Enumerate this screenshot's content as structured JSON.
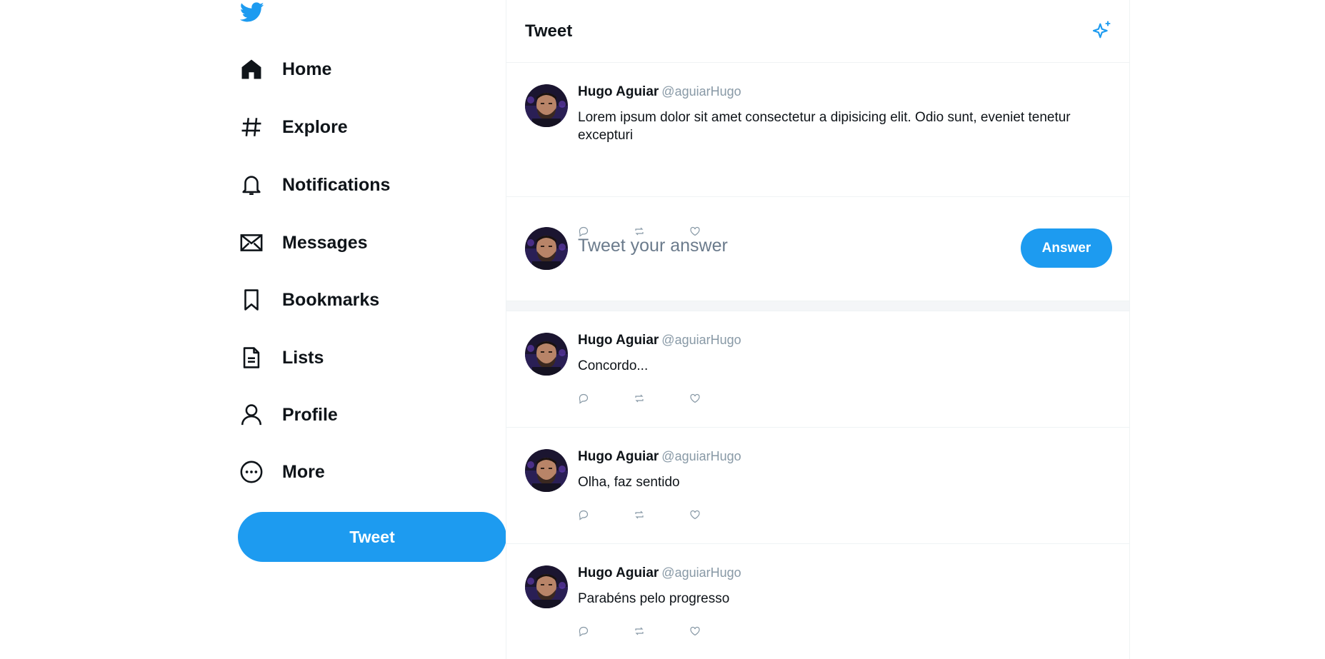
{
  "app": {
    "brand_color": "#1d9bf0"
  },
  "sidebar": {
    "logo_icon": "twitter-bird-icon",
    "items": [
      {
        "label": "Home",
        "icon": "home-icon"
      },
      {
        "label": "Explore",
        "icon": "hashtag-icon"
      },
      {
        "label": "Notifications",
        "icon": "bell-icon"
      },
      {
        "label": "Messages",
        "icon": "envelope-icon"
      },
      {
        "label": "Bookmarks",
        "icon": "bookmark-icon"
      },
      {
        "label": "Lists",
        "icon": "list-document-icon"
      },
      {
        "label": "Profile",
        "icon": "user-icon"
      },
      {
        "label": "More",
        "icon": "more-dots-icon"
      }
    ],
    "tweet_button": "Tweet"
  },
  "main": {
    "title": "Tweet",
    "tweet": {
      "name": "Hugo Aguiar",
      "handle": "@aguiarHugo",
      "text": "Lorem ipsum dolor sit amet consectetur a dipisicing elit. Odio sunt, eveniet tenetur excepturi"
    },
    "reply": {
      "placeholder": "Tweet your answer",
      "button": "Answer"
    },
    "replies": [
      {
        "name": "Hugo Aguiar",
        "handle": "@aguiarHugo",
        "text": "Concordo..."
      },
      {
        "name": "Hugo Aguiar",
        "handle": "@aguiarHugo",
        "text": "Olha, faz sentido"
      },
      {
        "name": "Hugo Aguiar",
        "handle": "@aguiarHugo",
        "text": "Parabéns pelo progresso"
      }
    ]
  }
}
